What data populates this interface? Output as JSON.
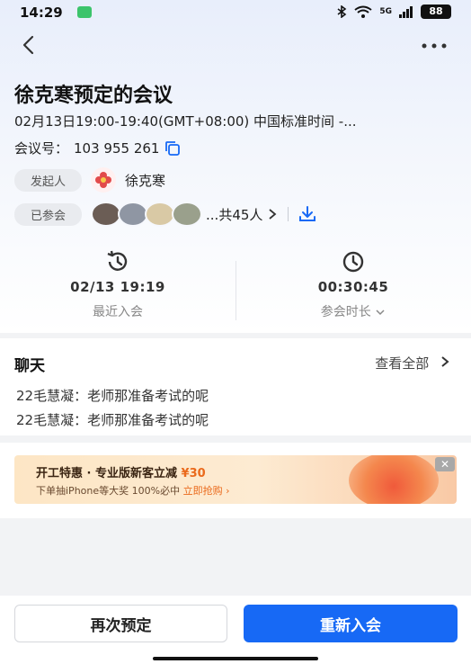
{
  "status_bar": {
    "time": "14:29",
    "network": "5G",
    "battery": "88"
  },
  "header": {
    "back_icon": "chevron-left-icon",
    "more_icon": "more-dots-icon"
  },
  "meeting": {
    "title": "徐克寒预定的会议",
    "time_range": "02月13日19:00-19:40(GMT+08:00) 中国标准时间 -...",
    "meeting_no_label": "会议号：",
    "meeting_no": "103 955 261",
    "host_label": "发起人",
    "host_name": "徐克寒",
    "joined_label": "已参会",
    "participant_count": "...共45人"
  },
  "stats": {
    "last_join_value": "02/13 19:19",
    "last_join_label": "最近入会",
    "duration_value": "00:30:45",
    "duration_label": "参会时长"
  },
  "chat": {
    "title": "聊天",
    "view_all": "查看全部",
    "messages": [
      "22毛慧凝：老师那准备考试的呢",
      "22毛慧凝：老师那准备考试的呢"
    ]
  },
  "promo": {
    "title_prefix": "开工特惠 · 专业版新客立减",
    "price": "¥30",
    "sub_prefix": "下单抽iPhone等大奖 100%必中",
    "cta": "立即抢购",
    "close": "✕"
  },
  "actions": {
    "rebook": "再次预定",
    "rejoin": "重新入会"
  },
  "colors": {
    "primary": "#1769f5",
    "promo_accent": "#ea6a1c"
  }
}
